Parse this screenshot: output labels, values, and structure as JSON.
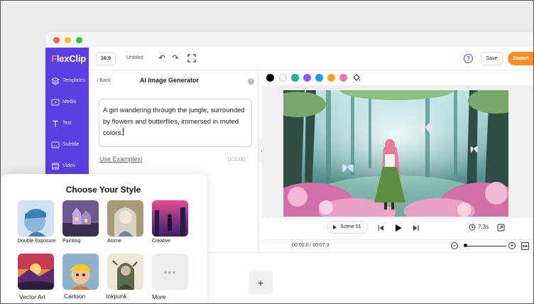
{
  "app": {
    "logo": "FlexClip",
    "logo_first_letter": "F",
    "logo_rest": "lexClip",
    "brand_color": "#5c3fe0",
    "accent_color": "#ff8c2b"
  },
  "sidebar": {
    "items": [
      {
        "label": "Templates",
        "icon": "templates-icon"
      },
      {
        "label": "Media",
        "icon": "media-icon"
      },
      {
        "label": "Text",
        "icon": "text-icon"
      },
      {
        "label": "Subtitle",
        "icon": "subtitle-icon"
      },
      {
        "label": "Video",
        "icon": "video-icon"
      }
    ]
  },
  "topbar": {
    "ratio": "16:9",
    "doc_title": "Untitled",
    "save_label": "Save",
    "export_label": "Export",
    "export_arrow": "→"
  },
  "panel": {
    "back_label": "Back",
    "title": "AI Image Generator",
    "help": "?",
    "prompt": "A girl wandering through the jungle, surrounded by flowers and butterflies, immersed in muted colors.",
    "use_examples": "Use Examples!",
    "char_count": "0/3000"
  },
  "colors": [
    "#000000",
    "#ffffff",
    "#1ab394",
    "#8b5cf6",
    "#1e9bf0",
    "#ff9f1c",
    "#f472b6"
  ],
  "player": {
    "scene_label": "Scene 01",
    "duration": "7.3s"
  },
  "timeline": {
    "time_readout": "00:00.0 / 00:07.3",
    "add_label": "+"
  },
  "style_picker": {
    "title": "Choose Your Style",
    "styles": [
      {
        "label": "Double Exposure"
      },
      {
        "label": "Painting"
      },
      {
        "label": "Anime"
      },
      {
        "label": "Creative"
      },
      {
        "label": "Vector Art"
      },
      {
        "label": "Cartoon"
      },
      {
        "label": "Inkpunk"
      },
      {
        "label": "More"
      }
    ]
  }
}
